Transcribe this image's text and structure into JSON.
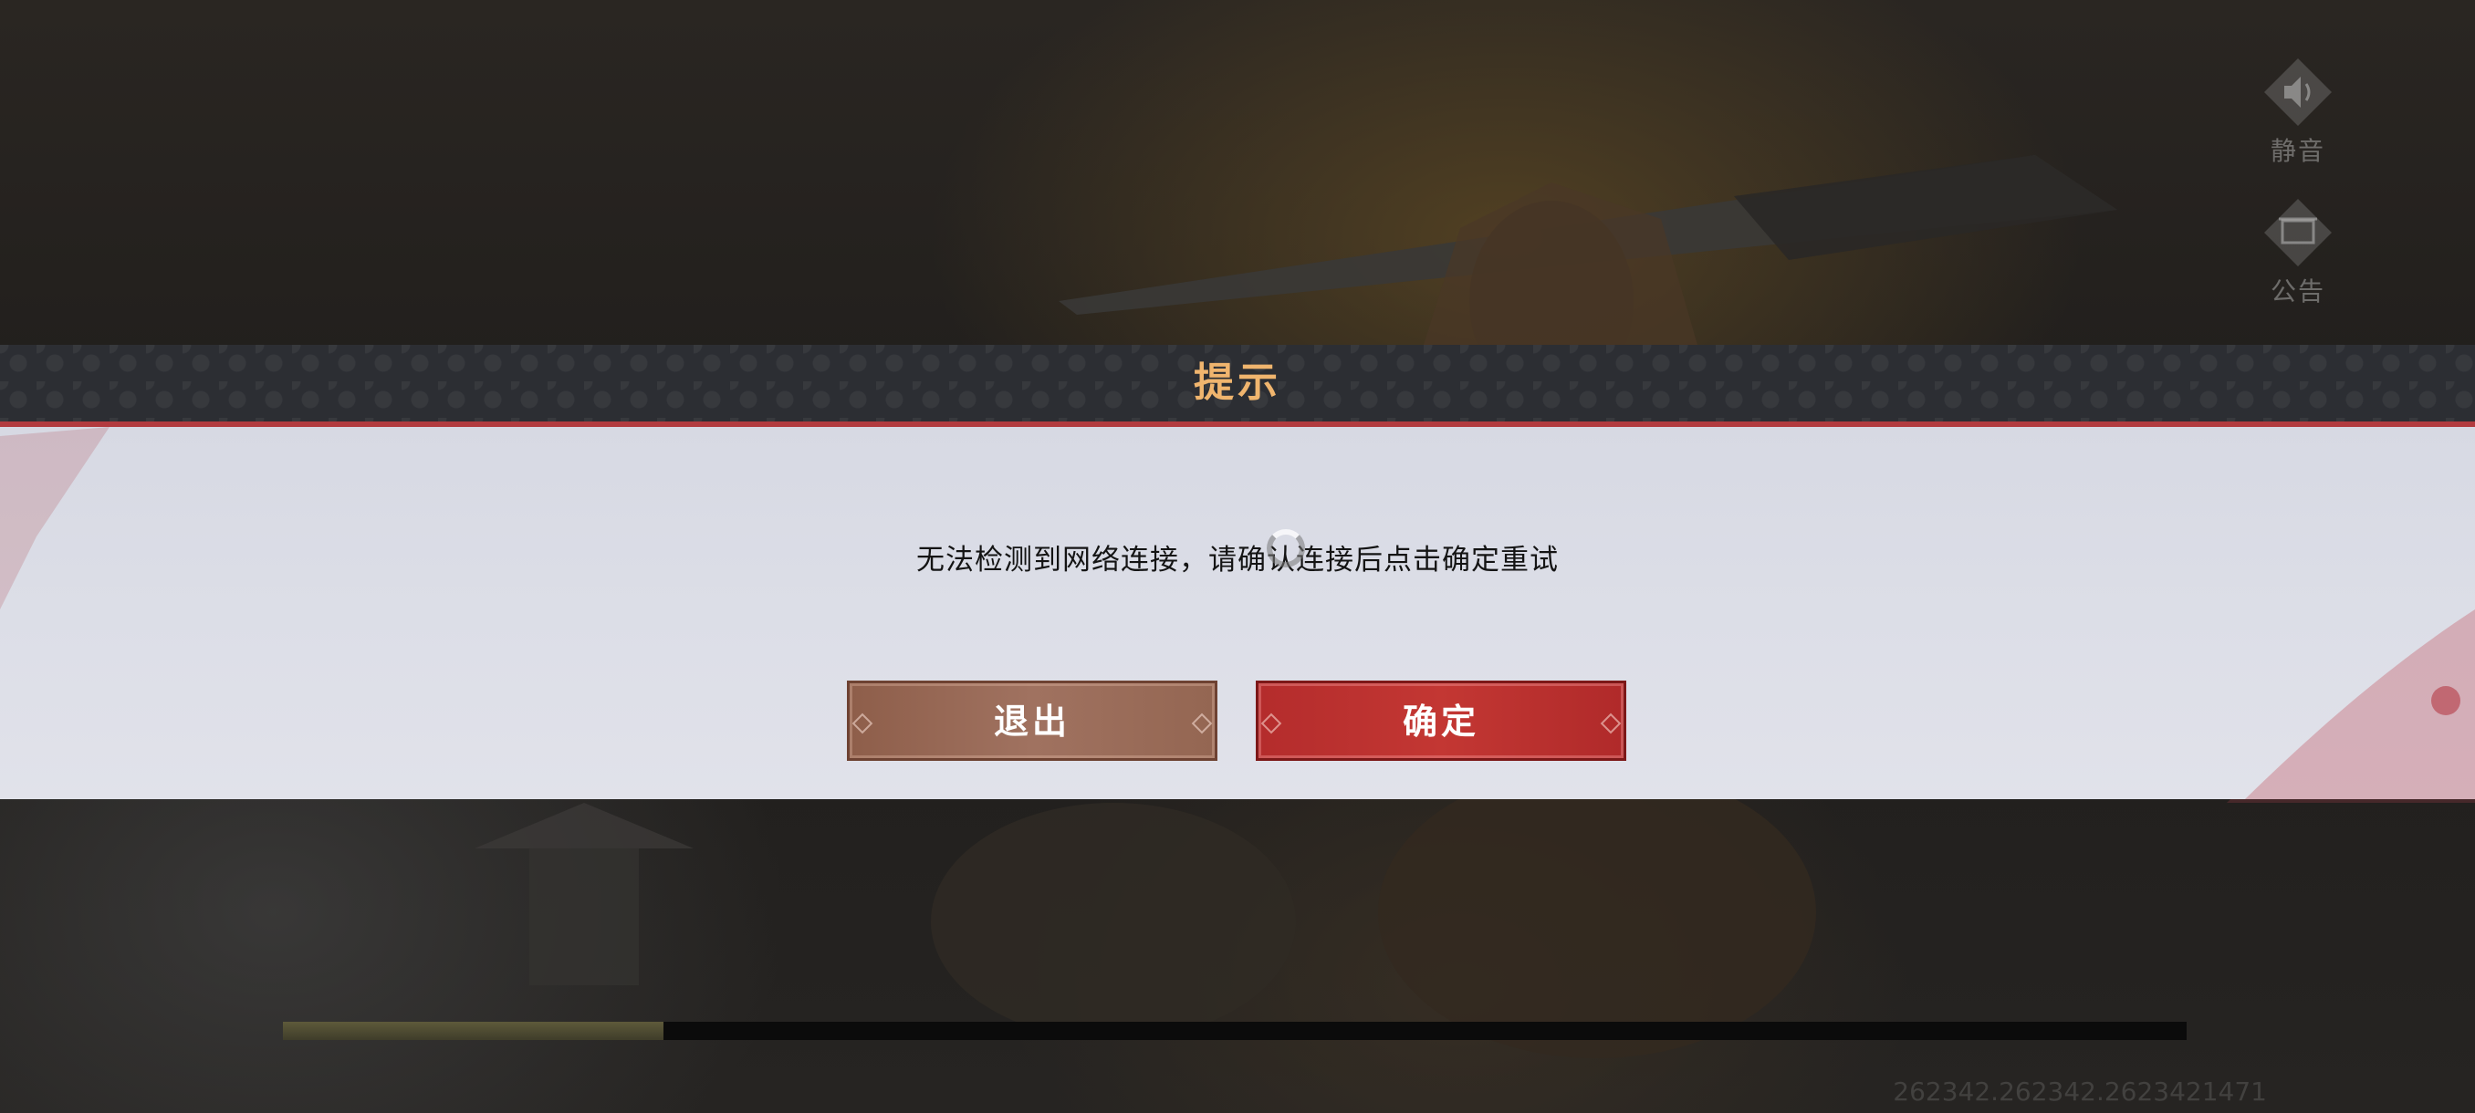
{
  "side_buttons": {
    "mute_label": "静音",
    "notice_label": "公告"
  },
  "dialog": {
    "title": "提示",
    "message": "无法检测到网络连接，请确认连接后点击确定重试",
    "exit_label": "退出",
    "confirm_label": "确定"
  },
  "loading": {
    "progress": 0.2
  },
  "footer": {
    "version_text": "262342.262342.2623421471"
  },
  "colors": {
    "title": "#f0b56e",
    "header_line": "#b23b3f",
    "exit_button": "#a07260",
    "confirm_button": "#c33733"
  }
}
